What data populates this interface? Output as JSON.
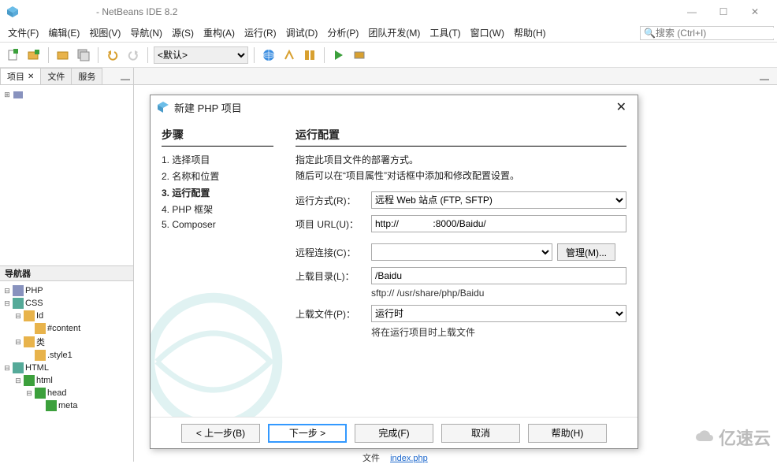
{
  "window": {
    "title": "- NetBeans IDE 8.2"
  },
  "menu": [
    "文件(F)",
    "编辑(E)",
    "视图(V)",
    "导航(N)",
    "源(S)",
    "重构(A)",
    "运行(R)",
    "调试(D)",
    "分析(P)",
    "团队开发(M)",
    "工具(T)",
    "窗口(W)",
    "帮助(H)"
  ],
  "search_placeholder": "搜索 (Ctrl+I)",
  "config_select": "<默认>",
  "left_tabs": {
    "projects": "项目",
    "files": "文件",
    "services": "服务"
  },
  "nav_header": "导航器",
  "nav_tree": {
    "php": "PHP",
    "css": "CSS",
    "id": "Id",
    "content": "#content",
    "cls": "类",
    "style1": ".style1",
    "html": "HTML",
    "html_el": "html",
    "head": "head",
    "meta": "meta"
  },
  "dialog": {
    "title": "新建 PHP 项目",
    "steps_header": "步骤",
    "steps": [
      "1. 选择项目",
      "2. 名称和位置",
      "3. 运行配置",
      "4. PHP 框架",
      "5. Composer"
    ],
    "current_step_index": 2,
    "content_header": "运行配置",
    "desc1": "指定此项目文件的部署方式。",
    "desc2": "随后可以在“项目属性”对话框中添加和修改配置设置。",
    "labels": {
      "run_as": "运行方式(R)：",
      "project_url": "项目 URL(U)：",
      "remote": "远程连接(C)：",
      "manage": "管理(M)...",
      "upload_dir": "上载目录(L)：",
      "upload_files": "上载文件(P)："
    },
    "values": {
      "run_as": "远程 Web 站点 (FTP, SFTP)",
      "project_url": "http://             :8000/Baidu/",
      "remote": "",
      "upload_dir": "/Baidu",
      "upload_dir_hint": "sftp://                 /usr/share/php/Baidu",
      "upload_files": "运行时",
      "upload_files_hint": "将在运行项目时上载文件"
    },
    "buttons": {
      "back": "< 上一步(B)",
      "next": "下一步 >",
      "finish": "完成(F)",
      "cancel": "取消",
      "help": "帮助(H)"
    }
  },
  "bottom": {
    "label": "文件",
    "link": "index.php"
  },
  "watermark": "亿速云"
}
